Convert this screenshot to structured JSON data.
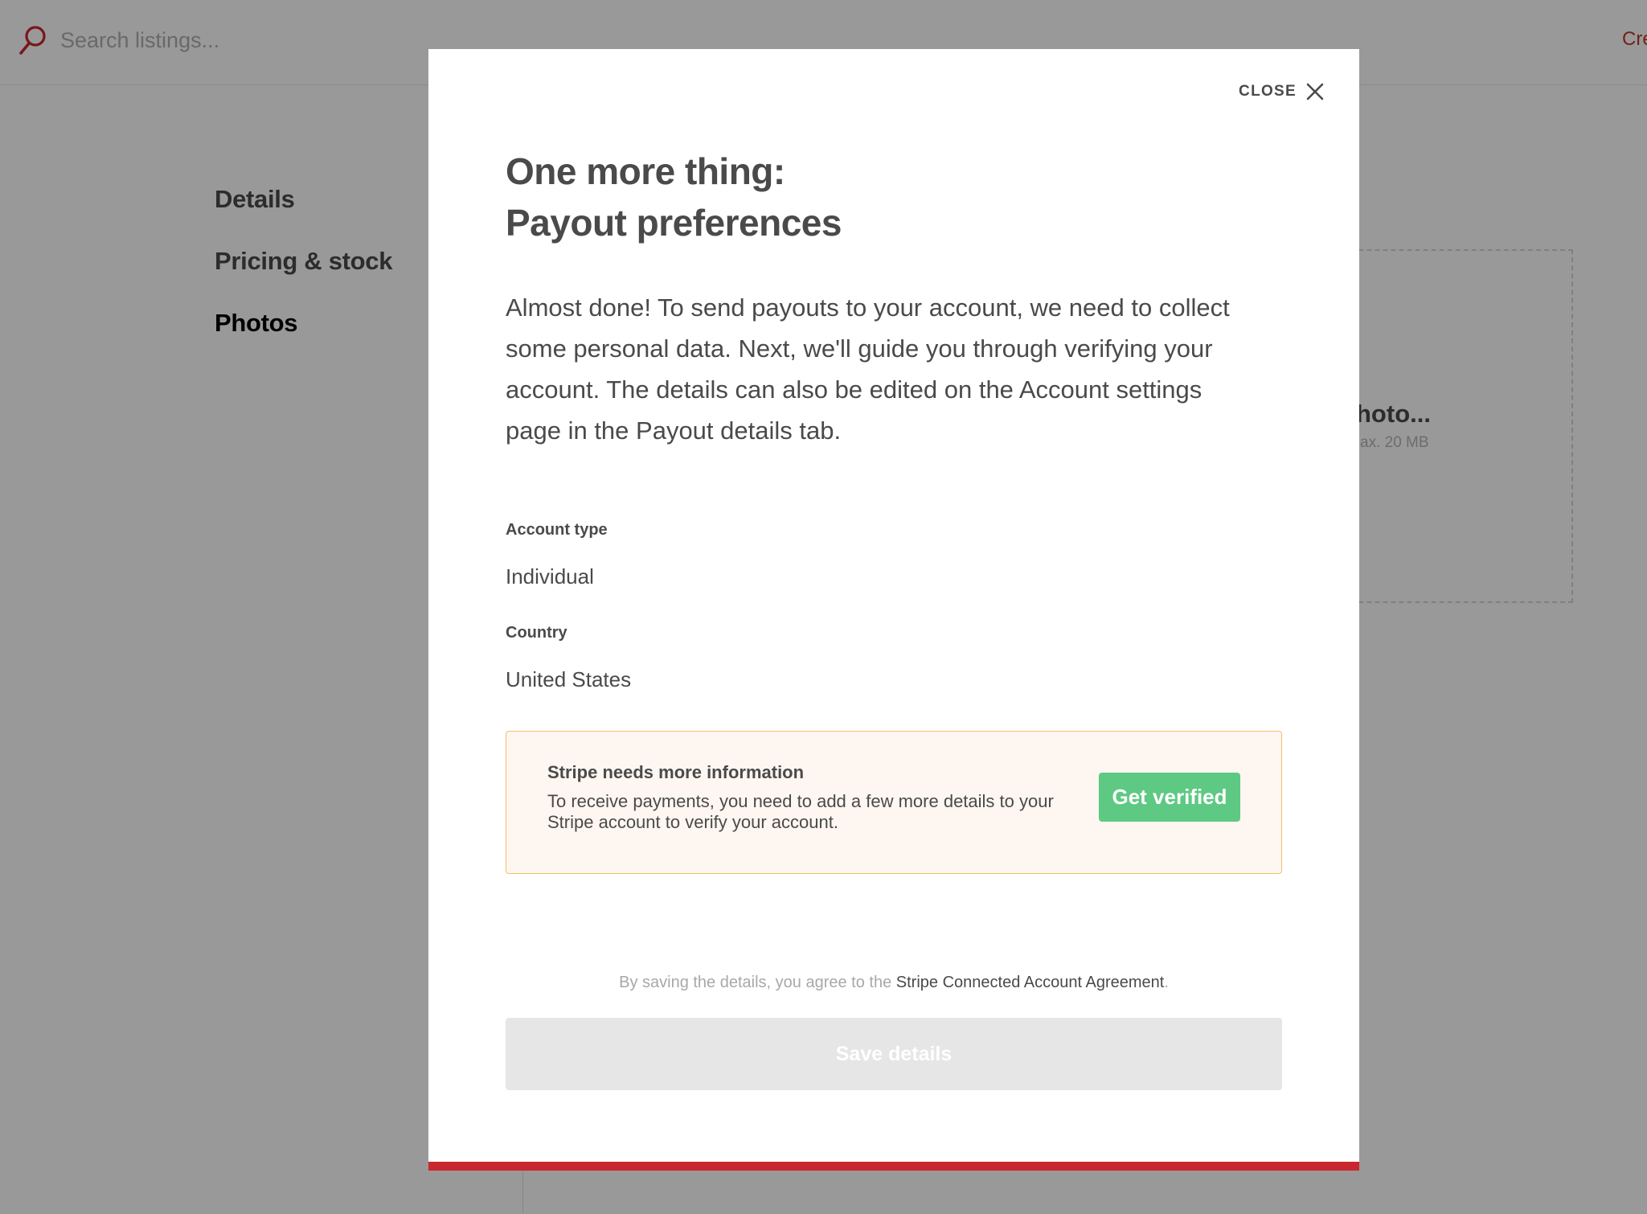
{
  "topbar": {
    "search_placeholder": "Search listings...",
    "create_link": "Cre"
  },
  "background": {
    "nav": [
      {
        "label": "Details"
      },
      {
        "label": "Pricing & stock"
      },
      {
        "label": "Photos"
      }
    ],
    "upload": {
      "title": "hoto...",
      "subtitle": "ax. 20 MB"
    }
  },
  "modal": {
    "close_label": "CLOSE",
    "title_line1": "One more thing:",
    "title_line2": "Payout preferences",
    "description": "Almost done! To send payouts to your account, we need to collect some personal data. Next, we'll guide you through verifying your account. The details can also be edited on the Account settings page in the Payout details tab.",
    "account_type_label": "Account type",
    "account_type_value": "Individual",
    "country_label": "Country",
    "country_value": "United States",
    "alert": {
      "title": "Stripe needs more information",
      "text": "To receive payments, you need to add a few more details to your Stripe account to verify your account.",
      "button": "Get verified"
    },
    "terms_prefix": "By saving the details, you agree to the ",
    "terms_link": "Stripe Connected Account Agreement",
    "terms_suffix": ".",
    "save_button": "Save details"
  },
  "colors": {
    "brand_red": "#c9272d",
    "verify_green": "#5dc982",
    "alert_border": "#f0c06b",
    "alert_bg": "#fef6f0"
  }
}
